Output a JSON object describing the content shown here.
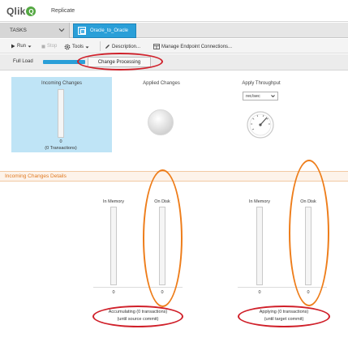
{
  "header": {
    "logo_text": "Qlik",
    "logo_mark": "Q",
    "app_name": "Replicate"
  },
  "tabs": {
    "tasks_label": "TASKS",
    "active_task": "Oracle_to_Oracle"
  },
  "toolbar": {
    "run": "Run",
    "stop": "Stop",
    "tools": "Tools",
    "description": "Description...",
    "manage_endpoints": "Manage Endpoint Connections..."
  },
  "mode": {
    "full_load": "Full Load",
    "change_processing": "Change Processing"
  },
  "overview": {
    "incoming_title": "Incoming Changes",
    "incoming_value": "0",
    "incoming_transactions": "(0 Transactions)",
    "applied_title": "Applied Changes",
    "throughput_title": "Apply Throughput",
    "throughput_unit": "rec/sec"
  },
  "details": {
    "title": "Incoming Changes Details",
    "accumulating": {
      "in_memory": "In Memory",
      "on_disk": "On Disk",
      "in_memory_value": "0",
      "on_disk_value": "0",
      "caption_line1": "Accumulating (0 transactions)",
      "caption_line2": "(until source commit)"
    },
    "applying": {
      "in_memory": "In Memory",
      "on_disk": "On Disk",
      "in_memory_value": "0",
      "on_disk_value": "0",
      "caption_line1": "Applying (0 transactions)",
      "caption_line2": "(until target commit)"
    }
  },
  "colors": {
    "accent_blue": "#2a9fd8",
    "panel_blue": "#bfe4f6",
    "annotation_red": "#d0202a",
    "annotation_orange": "#ee7d1a",
    "section_orange": "#e07a22",
    "logo_green": "#54a842"
  },
  "icons": {
    "run": "play-icon",
    "stop": "stop-icon",
    "tools": "gear-icon",
    "description": "edit-icon",
    "manage_endpoints": "endpoints-icon",
    "tasks_menu": "chevron-down-icon",
    "task": "task-icon",
    "throughput": "gauge-icon"
  }
}
